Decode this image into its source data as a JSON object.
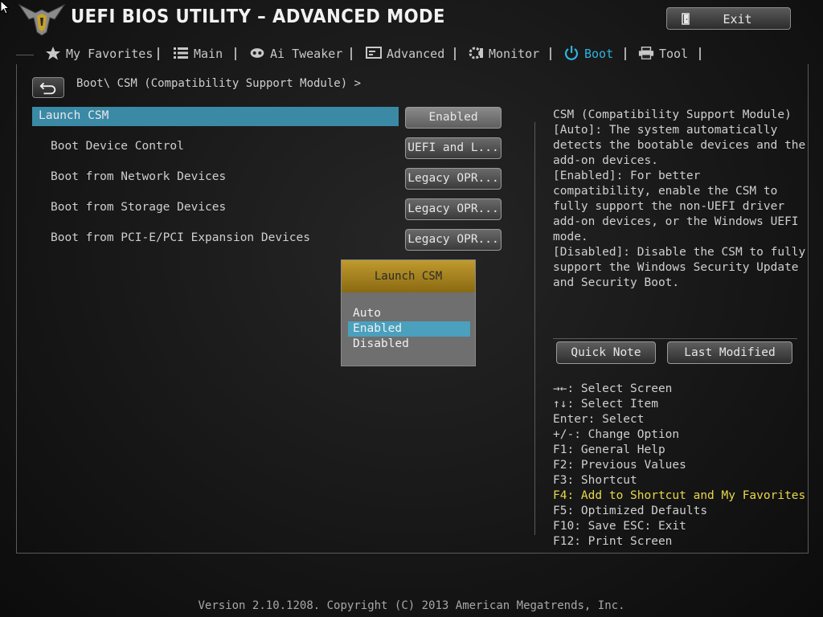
{
  "header": {
    "title": "UEFI BIOS UTILITY – ADVANCED MODE",
    "exit_label": "Exit"
  },
  "tabs": [
    {
      "label": "My Favorites",
      "icon": "star-icon"
    },
    {
      "label": "Main",
      "icon": "list-icon"
    },
    {
      "label": "Ai Tweaker",
      "icon": "tweaker-icon"
    },
    {
      "label": "Advanced",
      "icon": "advanced-icon"
    },
    {
      "label": "Monitor",
      "icon": "monitor-icon"
    },
    {
      "label": "Boot",
      "icon": "power-icon",
      "active": true
    },
    {
      "label": "Tool",
      "icon": "printer-icon"
    }
  ],
  "breadcrumb": "Boot\\ CSM (Compatibility Support Module) >",
  "settings": [
    {
      "label": "Launch CSM",
      "value": "Enabled"
    },
    {
      "label": "Boot Device Control",
      "value": "UEFI and L..."
    },
    {
      "label": "Boot from Network Devices",
      "value": "Legacy OPR..."
    },
    {
      "label": "Boot from Storage Devices",
      "value": "Legacy OPR..."
    },
    {
      "label": "Boot from PCI-E/PCI Expansion Devices",
      "value": "Legacy OPR..."
    }
  ],
  "popup": {
    "title": "Launch CSM",
    "options": [
      "Auto",
      "Enabled",
      "Disabled"
    ],
    "selected": "Enabled"
  },
  "help_lines": [
    "CSM (Compatibility Support Module)",
    "[Auto]: The system automatically",
    "detects the bootable devices and the",
    "add-on devices.",
    "[Enabled]:  For better",
    "compatibility, enable the CSM to",
    "fully support the non-UEFI driver",
    "add-on devices, or the Windows UEFI",
    "mode.",
    "[Disabled]: Disable the CSM to fully",
    "support the Windows Security Update",
    "and Security Boot."
  ],
  "panel_buttons": {
    "quick_note": "Quick Note",
    "last_modified": "Last Modified"
  },
  "keys": [
    {
      "text": "→←: Select Screen"
    },
    {
      "text": "↑↓: Select Item"
    },
    {
      "text": "Enter: Select"
    },
    {
      "text": "+/-: Change Option"
    },
    {
      "text": "F1: General Help"
    },
    {
      "text": "F2: Previous Values"
    },
    {
      "text": "F3: Shortcut"
    },
    {
      "text": "F4: Add to Shortcut and My Favorites",
      "highlight": true
    },
    {
      "text": "F5: Optimized Defaults"
    },
    {
      "text": "F10: Save  ESC: Exit"
    },
    {
      "text": "F12: Print Screen"
    }
  ],
  "footer": "Version 2.10.1208. Copyright (C) 2013 American Megatrends, Inc.",
  "colors": {
    "accent": "#2fb3e0",
    "row_highlight": "#3a8aa6",
    "popup_header": "#b08a22",
    "shortcut_highlight": "#e8d84a"
  }
}
